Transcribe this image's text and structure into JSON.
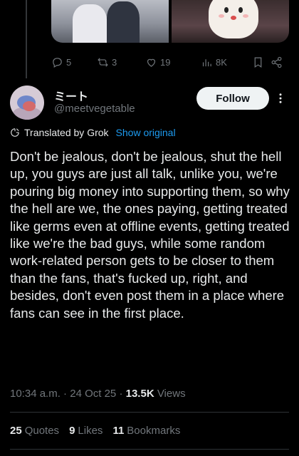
{
  "prev_post": {
    "actions": {
      "replies": "5",
      "reposts": "3",
      "likes": "19",
      "views": "8K"
    },
    "icons": [
      "reply-icon",
      "repost-icon",
      "like-icon",
      "views-icon",
      "bookmark-icon",
      "share-icon"
    ]
  },
  "author": {
    "name": "ミート",
    "handle": "@meetvegetable",
    "follow_label": "Follow"
  },
  "translation": {
    "label": "Translated by Grok",
    "link": "Show original"
  },
  "post": {
    "text": "Don't be jealous, don't be jealous, shut the hell up, you guys are just all talk, unlike you, we're pouring big money into supporting them, so why the hell are we, the ones paying, getting treated like germs even at offline events, getting treated like we're the bad guys, while some random work-related person gets to be closer to them than the fans, that's fucked up, right, and besides, don't even post them in a place where fans can see in the first place."
  },
  "meta": {
    "time": "10:34 a.m.",
    "date": "24 Oct 25",
    "views_count": "13.5K",
    "views_label": "Views"
  },
  "stats": {
    "quotes_count": "25",
    "quotes_label": "Quotes",
    "likes_count": "9",
    "likes_label": "Likes",
    "bookmarks_count": "11",
    "bookmarks_label": "Bookmarks"
  },
  "colors": {
    "background": "#000000",
    "text": "#e7e9ea",
    "muted": "#71767b",
    "link": "#1d9bf0",
    "follow_bg": "#eff3f4"
  }
}
